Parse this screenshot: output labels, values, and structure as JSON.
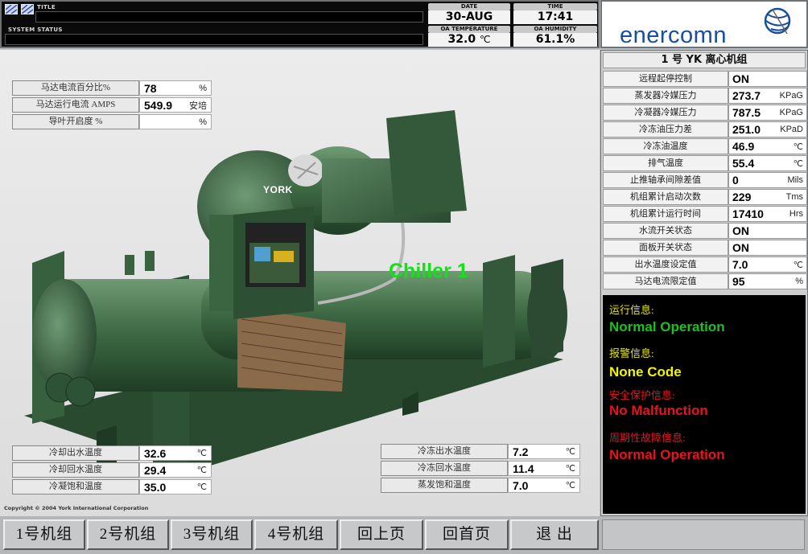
{
  "header": {
    "title_label": "TITLE",
    "system_status_label": "SYSTEM STATUS",
    "date_label": "DATE",
    "date_value": "30-AUG",
    "time_label": "TIME",
    "time_value": "17:41",
    "oa_temp_label": "OA TEMPERATURE",
    "oa_temp_value": "32.0",
    "oa_temp_unit": "℃",
    "oa_humidity_label": "OA HUMIDITY",
    "oa_humidity_value": "61.1%"
  },
  "logo": {
    "text": "enercomn"
  },
  "motor": [
    {
      "label": "马达电流百分比%",
      "value": "78",
      "unit": "%"
    },
    {
      "label": "马达运行电流 AMPS",
      "value": "549.9",
      "unit": "安培"
    },
    {
      "label": "导叶开启度 %",
      "value": "",
      "unit": "%"
    }
  ],
  "chiller_label": "Chiller 1",
  "york_label": "YORK",
  "cooling_water": [
    {
      "label": "冷却出水温度",
      "value": "32.6",
      "unit": "℃"
    },
    {
      "label": "冷却回水温度",
      "value": "29.4",
      "unit": "℃"
    },
    {
      "label": "冷凝饱和温度",
      "value": "35.0",
      "unit": "℃"
    }
  ],
  "chilled_water": [
    {
      "label": "冷冻出水温度",
      "value": "7.2",
      "unit": "℃"
    },
    {
      "label": "冷冻回水温度",
      "value": "11.4",
      "unit": "℃"
    },
    {
      "label": "蒸发饱和温度",
      "value": "7.0",
      "unit": "℃"
    }
  ],
  "copyright": "Copyright © 2004 York International Corporation",
  "panel": {
    "title": "1 号 YK 离心机组",
    "rows": [
      {
        "label": "远程起停控制",
        "value": "ON",
        "unit": ""
      },
      {
        "label": "蒸发器冷媒压力",
        "value": "273.7",
        "unit": "KPaG"
      },
      {
        "label": "冷凝器冷媒压力",
        "value": "787.5",
        "unit": "KPaG"
      },
      {
        "label": "冷冻油压力差",
        "value": "251.0",
        "unit": "KPaD"
      },
      {
        "label": "冷冻油温度",
        "value": "46.9",
        "unit": "℃"
      },
      {
        "label": "排气温度",
        "value": "55.4",
        "unit": "℃"
      },
      {
        "label": "止推轴承间隙差值",
        "value": "0",
        "unit": "Mils"
      },
      {
        "label": "机组累计启动次数",
        "value": "229",
        "unit": "Tms"
      },
      {
        "label": "机组累计运行时间",
        "value": "17410",
        "unit": "Hrs"
      },
      {
        "label": "水流开关状态",
        "value": "ON",
        "unit": ""
      },
      {
        "label": "面板开关状态",
        "value": "ON",
        "unit": ""
      },
      {
        "label": "出水温度设定值",
        "value": "7.0",
        "unit": "℃"
      },
      {
        "label": "马达电流限定值",
        "value": "95",
        "unit": "%"
      }
    ],
    "status": {
      "run_label": "运行信息:",
      "run_value": "Normal Operation",
      "alarm_label": "报警信息:",
      "alarm_value": "None Code",
      "safety_label": "安全保护信息:",
      "safety_value": "No Malfunction",
      "cycling_label": "周期性故障信息:",
      "cycling_value": "Normal Operation"
    }
  },
  "nav": [
    "1号机组",
    "2号机组",
    "3号机组",
    "4号机组",
    "回上页",
    "回首页",
    "退 出"
  ],
  "colors": {
    "equipment_green": "#3f6b45",
    "status_green": "#19c21e",
    "status_yellow": "#f4f300",
    "status_red": "#e8141b",
    "logo_blue": "#1a4d9c"
  }
}
